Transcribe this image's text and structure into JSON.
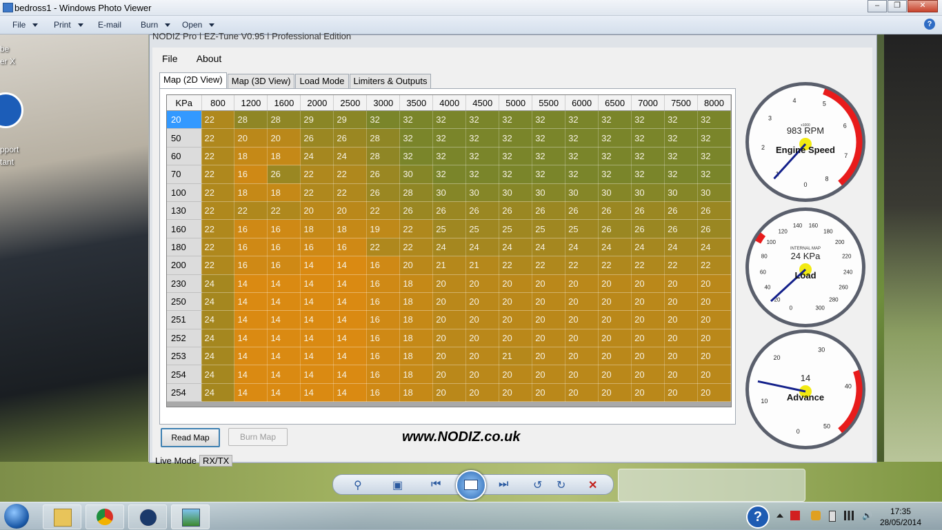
{
  "window": {
    "title": "bedross1 - Windows Photo Viewer"
  },
  "menubar": {
    "file": "File",
    "print": "Print",
    "email": "E-mail",
    "burn": "Burn",
    "open": "Open"
  },
  "desktop": {
    "label_1a": "be",
    "label_1b": "er X",
    "label_2a": "pport",
    "label_2b": "tant"
  },
  "app": {
    "title": "NODIZ Pro | EZ-Tune V0.95 | Professional Edition",
    "menu": {
      "file": "File",
      "about": "About"
    },
    "tabs": [
      "Map (2D View)",
      "Map (3D View)",
      "Load Mode",
      "Limiters & Outputs"
    ],
    "table": {
      "corner": "KPa",
      "rpm": [
        "800",
        "1200",
        "1600",
        "2000",
        "2500",
        "3000",
        "3500",
        "4000",
        "4500",
        "5000",
        "5500",
        "6000",
        "6500",
        "7000",
        "7500",
        "8000"
      ],
      "rows": [
        {
          "kpa": "20",
          "vals": [
            22,
            28,
            28,
            29,
            29,
            32,
            32,
            32,
            32,
            32,
            32,
            32,
            32,
            32,
            32,
            32
          ]
        },
        {
          "kpa": "50",
          "vals": [
            22,
            20,
            20,
            26,
            26,
            28,
            32,
            32,
            32,
            32,
            32,
            32,
            32,
            32,
            32,
            32
          ]
        },
        {
          "kpa": "60",
          "vals": [
            22,
            18,
            18,
            24,
            24,
            28,
            32,
            32,
            32,
            32,
            32,
            32,
            32,
            32,
            32,
            32
          ]
        },
        {
          "kpa": "70",
          "vals": [
            22,
            16,
            26,
            22,
            22,
            26,
            30,
            32,
            32,
            32,
            32,
            32,
            32,
            32,
            32,
            32
          ]
        },
        {
          "kpa": "100",
          "vals": [
            22,
            18,
            18,
            22,
            22,
            26,
            28,
            30,
            30,
            30,
            30,
            30,
            30,
            30,
            30,
            30
          ]
        },
        {
          "kpa": "130",
          "vals": [
            22,
            22,
            22,
            20,
            20,
            22,
            26,
            26,
            26,
            26,
            26,
            26,
            26,
            26,
            26,
            26
          ]
        },
        {
          "kpa": "160",
          "vals": [
            22,
            16,
            16,
            18,
            18,
            19,
            22,
            25,
            25,
            25,
            25,
            25,
            26,
            26,
            26,
            26
          ]
        },
        {
          "kpa": "180",
          "vals": [
            22,
            16,
            16,
            16,
            16,
            22,
            22,
            24,
            24,
            24,
            24,
            24,
            24,
            24,
            24,
            24
          ]
        },
        {
          "kpa": "200",
          "vals": [
            22,
            16,
            16,
            14,
            14,
            16,
            20,
            21,
            21,
            22,
            22,
            22,
            22,
            22,
            22,
            22
          ]
        },
        {
          "kpa": "230",
          "vals": [
            24,
            14,
            14,
            14,
            14,
            16,
            18,
            20,
            20,
            20,
            20,
            20,
            20,
            20,
            20,
            20
          ]
        },
        {
          "kpa": "250",
          "vals": [
            24,
            14,
            14,
            14,
            14,
            16,
            18,
            20,
            20,
            20,
            20,
            20,
            20,
            20,
            20,
            20
          ]
        },
        {
          "kpa": "251",
          "vals": [
            24,
            14,
            14,
            14,
            14,
            16,
            18,
            20,
            20,
            20,
            20,
            20,
            20,
            20,
            20,
            20
          ]
        },
        {
          "kpa": "252",
          "vals": [
            24,
            14,
            14,
            14,
            14,
            16,
            18,
            20,
            20,
            20,
            20,
            20,
            20,
            20,
            20,
            20
          ]
        },
        {
          "kpa": "253",
          "vals": [
            24,
            14,
            14,
            14,
            14,
            16,
            18,
            20,
            20,
            21,
            20,
            20,
            20,
            20,
            20,
            20
          ]
        },
        {
          "kpa": "254",
          "vals": [
            24,
            14,
            14,
            14,
            14,
            16,
            18,
            20,
            20,
            20,
            20,
            20,
            20,
            20,
            20,
            20
          ]
        },
        {
          "kpa": "254",
          "vals": [
            24,
            14,
            14,
            14,
            14,
            16,
            18,
            20,
            20,
            20,
            20,
            20,
            20,
            20,
            20,
            20
          ]
        }
      ]
    },
    "gauges": {
      "rpm": {
        "label": "Engine Speed",
        "readout": "983 RPM",
        "multiplier": "x1000",
        "ticks": [
          "0",
          "1",
          "2",
          "3",
          "4",
          "5",
          "6",
          "7",
          "8"
        ],
        "value": 0.983,
        "min": 0,
        "max": 8
      },
      "load": {
        "label": "Load",
        "readout": "24 KPa",
        "sub": "INTERNAL MAP",
        "ticks": [
          "0",
          "20",
          "40",
          "60",
          "80",
          "100",
          "120",
          "140",
          "160",
          "180",
          "200",
          "220",
          "240",
          "260",
          "280",
          "300"
        ],
        "value": 24,
        "min": 0,
        "max": 300
      },
      "advance": {
        "label": "Advance",
        "readout": "14",
        "ticks": [
          "0",
          "10",
          "20",
          "30",
          "40",
          "50"
        ],
        "value": 14,
        "min": 0,
        "max": 50
      }
    },
    "buttons": {
      "read_map": "Read Map",
      "burn_map": "Burn Map"
    },
    "url": "www.NODIZ.co.uk",
    "live_mode": "Live Mode",
    "rxtx": "RX/TX"
  },
  "colors": {
    "cell_olive": "#7f8a2a",
    "cell_orange": "#d98a10",
    "selected": "#3399ff",
    "redline": "#e81b1b"
  },
  "taskbar": {
    "time": "17:35",
    "date": "28/05/2014"
  }
}
